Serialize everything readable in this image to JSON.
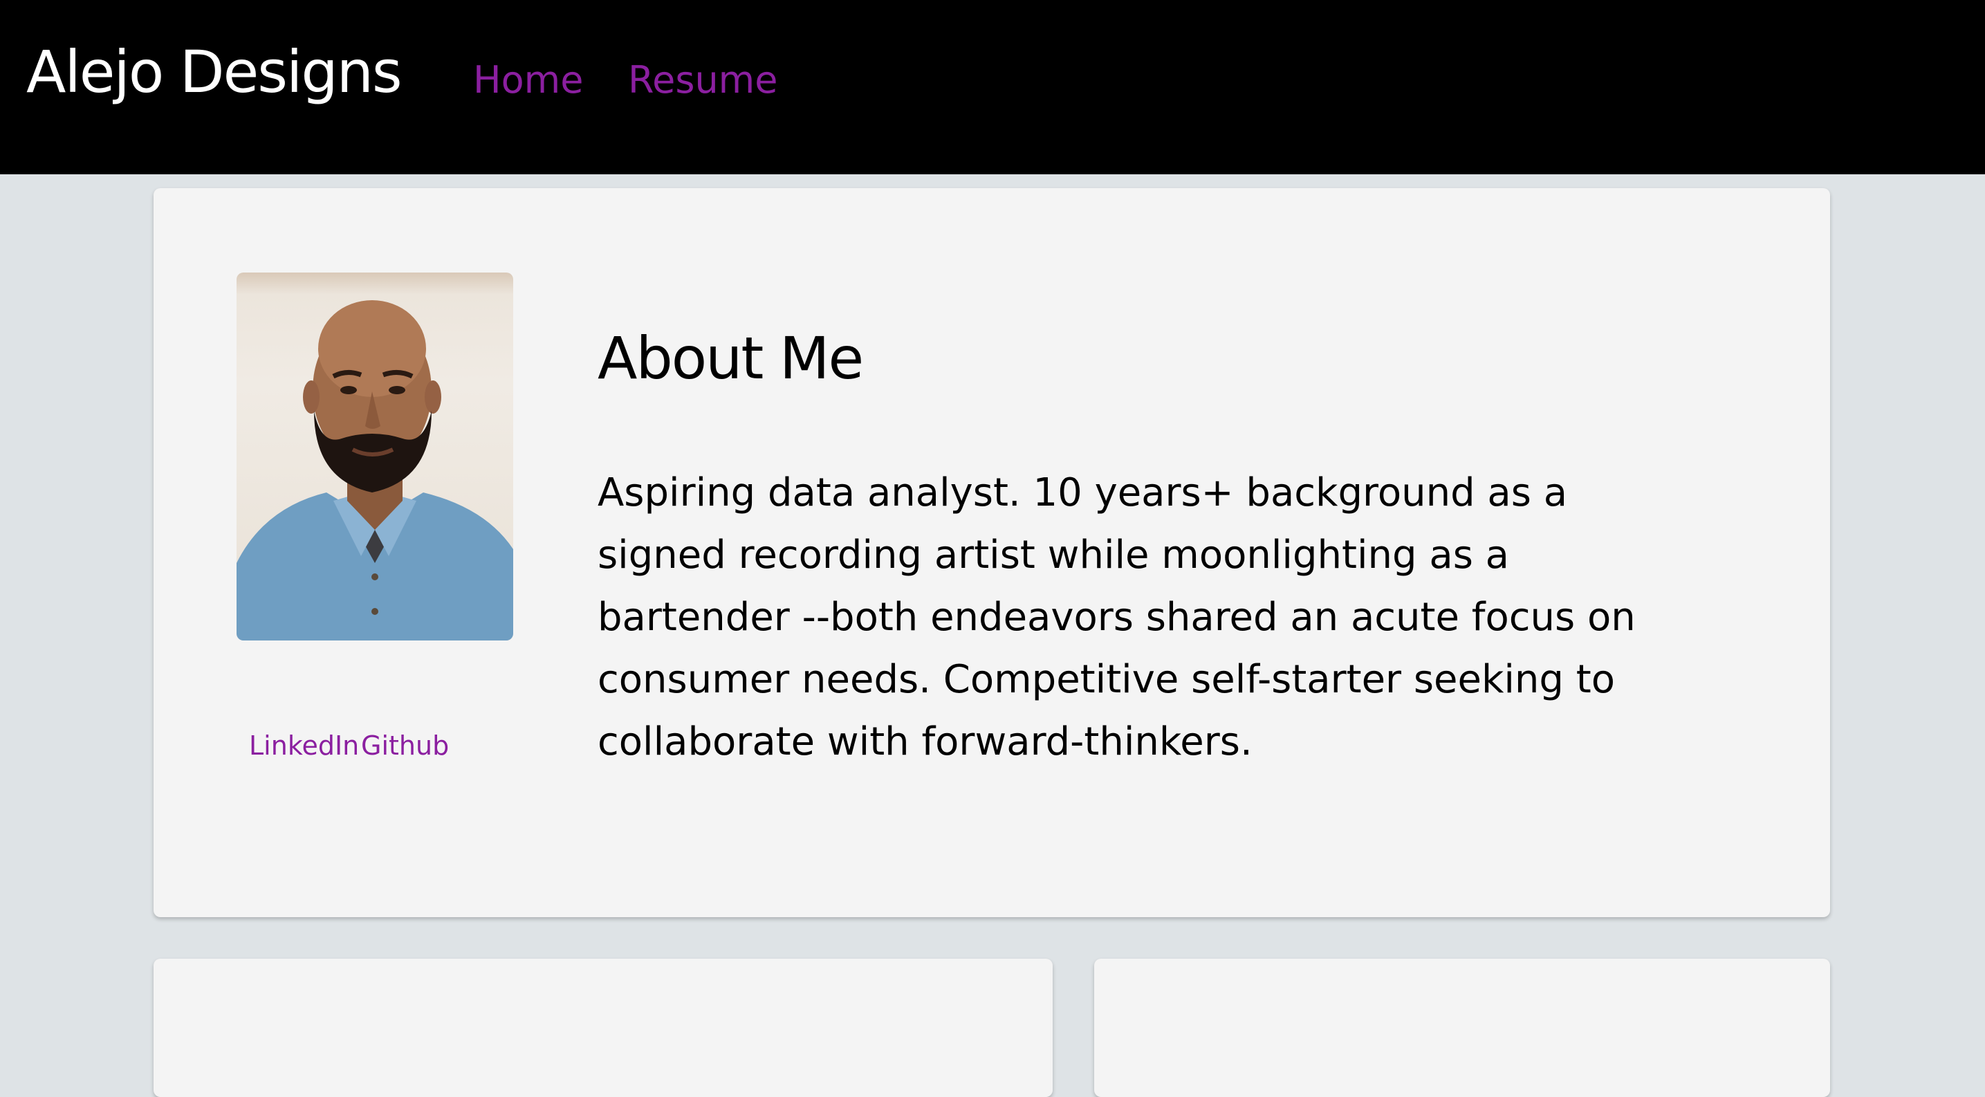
{
  "navbar": {
    "brand": "Alejo Designs",
    "links": [
      {
        "label": "Home"
      },
      {
        "label": "Resume"
      }
    ]
  },
  "about": {
    "title": "About Me",
    "description": "Aspiring data analyst. 10 years+ background as a signed recording artist while moonlighting as a bartender --both endeavors shared an acute focus on consumer needs. Competitive self-starter seeking to collaborate with forward-thinkers.",
    "social_links": [
      {
        "label": "LinkedIn"
      },
      {
        "label": "Github"
      }
    ]
  },
  "colors": {
    "navbar_bg": "#000000",
    "link": "#8b1fa0",
    "page_bg": "#dee3e6",
    "card_bg": "#f4f4f4"
  }
}
